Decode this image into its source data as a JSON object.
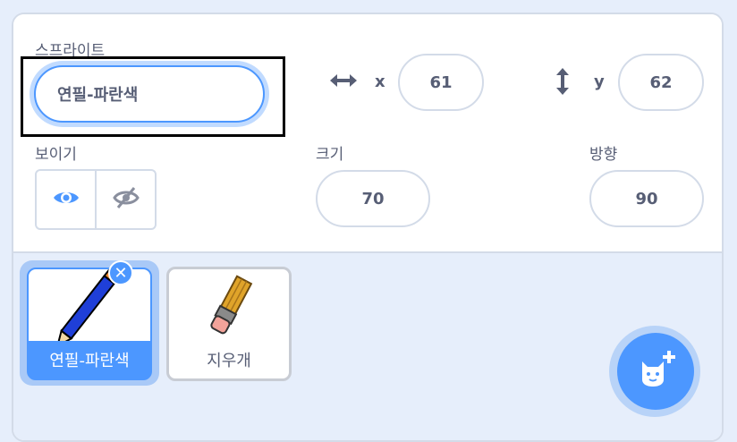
{
  "sprite_label": "스프라이트",
  "sprite_name": "연필-파란색",
  "x_label": "x",
  "x_value": "61",
  "y_label": "y",
  "y_value": "62",
  "show_label": "보이기",
  "size_label": "크기",
  "size_value": "70",
  "direction_label": "방향",
  "direction_value": "90",
  "sprites": [
    {
      "name": "연필-파란색",
      "selected": true
    },
    {
      "name": "지우개",
      "selected": false
    }
  ],
  "colors": {
    "accent": "#4c97ff",
    "text": "#575e75",
    "border": "#d3dbe8"
  }
}
